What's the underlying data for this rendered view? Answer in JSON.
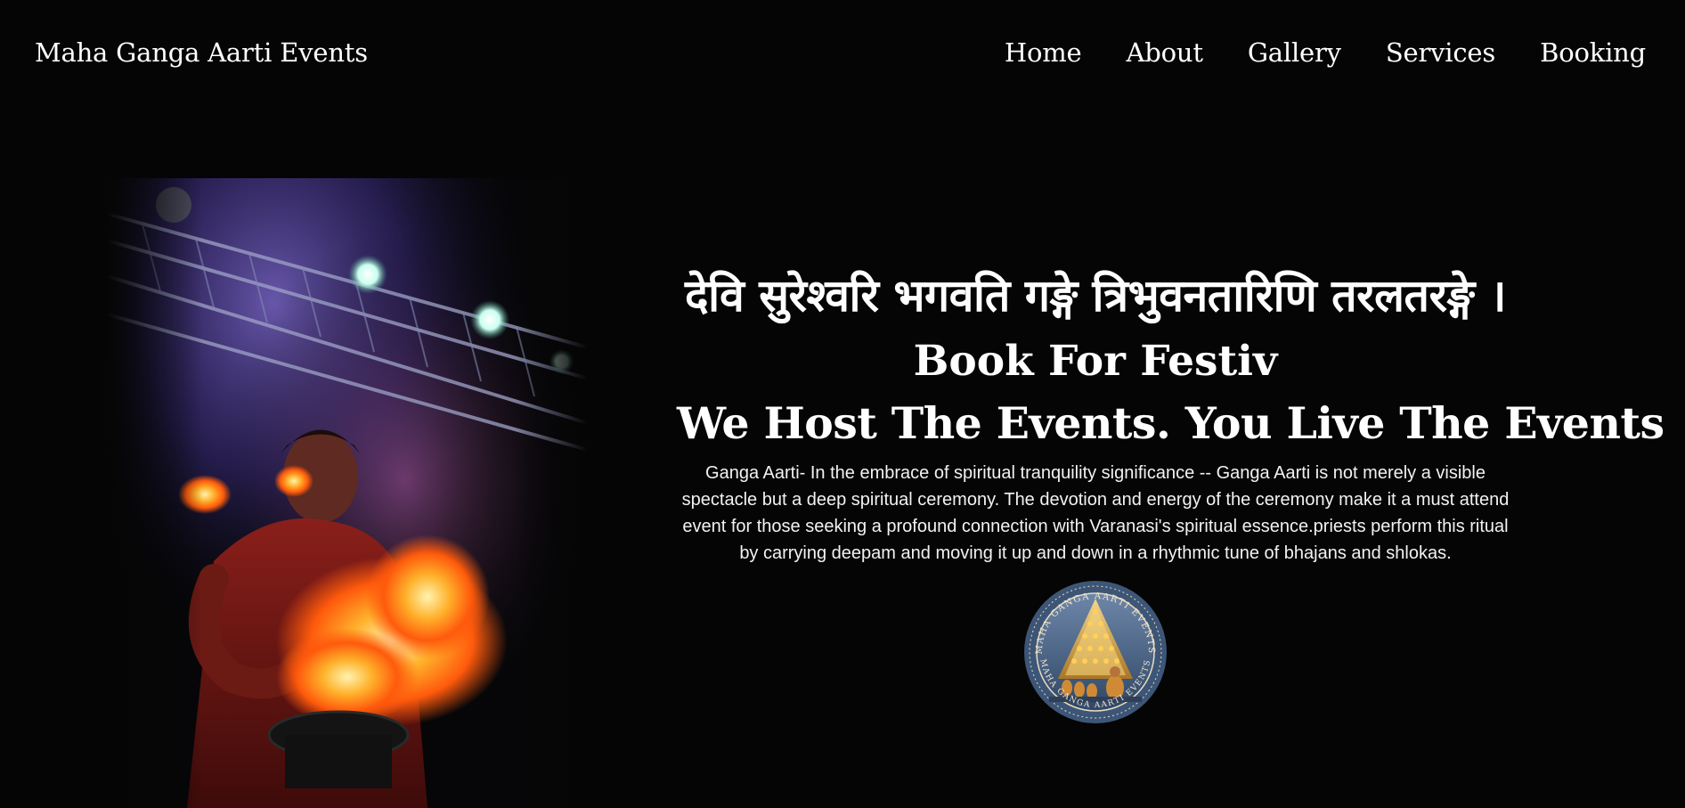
{
  "header": {
    "brand": "Maha Ganga Aarti Events",
    "nav": [
      {
        "label": "Home"
      },
      {
        "label": "About"
      },
      {
        "label": "Gallery"
      },
      {
        "label": "Services"
      },
      {
        "label": "Booking"
      }
    ]
  },
  "hero": {
    "photo_icon": "priest-performing-aarti-image",
    "mantra": "देवि सुरेश्वरि भगवति गङ्गे त्रिभुवनतारिणि तरलतरङ्गे ।",
    "subtitle": "Book For Festiv",
    "headline": "We Host The Events. You Live The Events",
    "description": "Ganga Aarti- In the embrace of spiritual tranquility significance -- Ganga Aarti is not merely a visible spectacle but a deep spiritual ceremony. The devotion and energy of the ceremony make it a must attend event for those seeking a profound connection with Varanasi's spiritual essence.priests perform this ritual by carrying deepam and moving it up and down in a rhythmic tune of bhajans and shlokas.",
    "logo": {
      "icon": "maha-ganga-aarti-events-seal",
      "text_top": "MAHA GANGA AARTI EVENTS",
      "text_bottom": "MAHA GANGA AARTI EVENTS"
    }
  },
  "colors": {
    "background": "#050505",
    "text": "#ffffff",
    "seal_blue": "#3d5677",
    "flame": "#ff8a1c",
    "smoke": "#6a4fb0"
  }
}
